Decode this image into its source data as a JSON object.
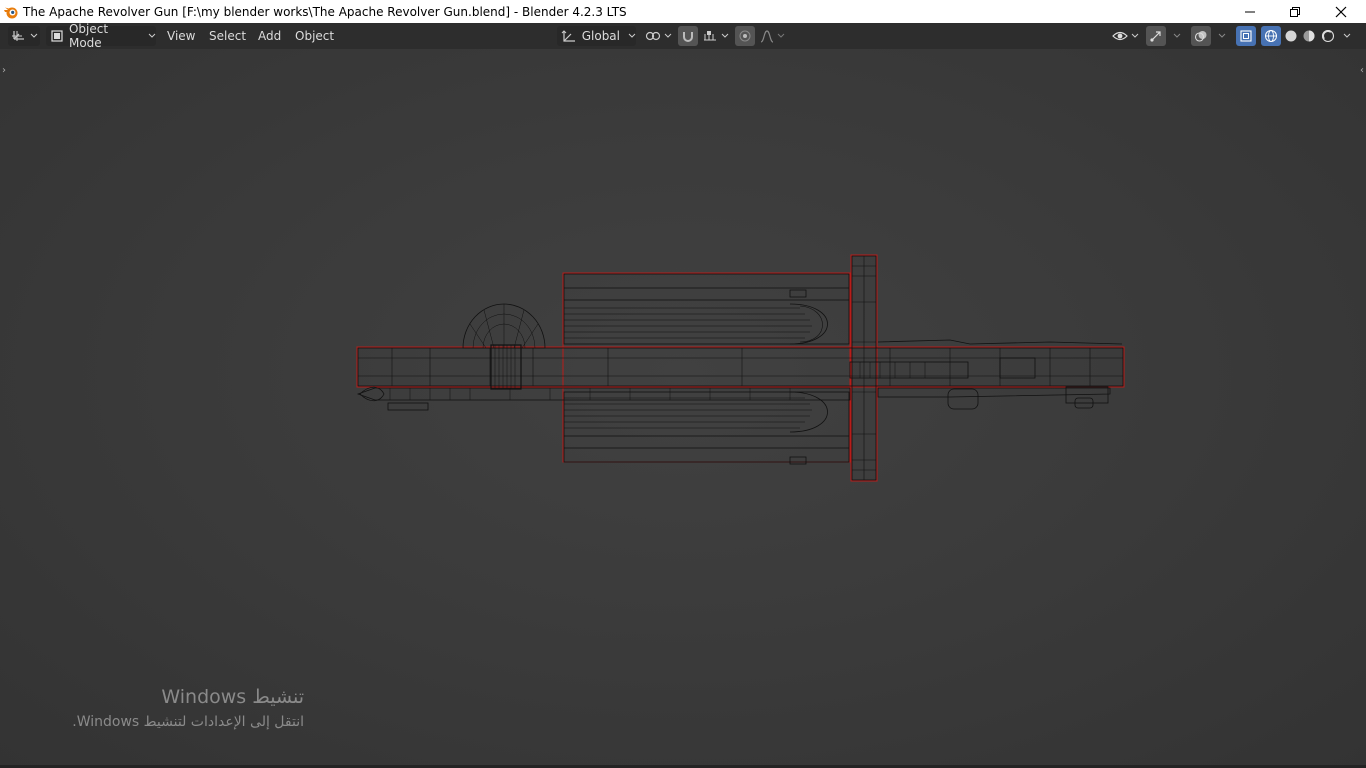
{
  "window": {
    "title": "The Apache Revolver Gun [F:\\my blender works\\The Apache Revolver Gun.blend] - Blender 4.2.3 LTS",
    "controls": [
      "minimize-icon",
      "restore-icon",
      "close-icon"
    ]
  },
  "header": {
    "editor_type_icon": "3d-viewport-icon",
    "mode": {
      "label": "Object Mode",
      "icon": "object-mode-icon"
    },
    "menus": [
      "View",
      "Select",
      "Add",
      "Object"
    ],
    "transform_orientation": {
      "label": "Global",
      "icon": "orientation-icon"
    },
    "pivot_icon": "pivot-point-icon",
    "snap_icon": "snap-magnet-icon",
    "snap_target_icon": "snap-increment-icon",
    "proportional_edit_icon": "proportional-edit-icon",
    "falloff_icon": "falloff-curve-icon",
    "visibility_icon": "eye-visibility-icon",
    "gizmo_icon": "gizmo-icon",
    "overlay_icon": "overlay-icon",
    "xray_icon": "xray-icon",
    "shading_modes": [
      "wireframe",
      "solid",
      "material-preview",
      "rendered"
    ],
    "active_shading": "wireframe",
    "colors": {
      "accent": "#4772b3",
      "header_bg": "#2d2d2d",
      "wire": "#0e0e0e",
      "selection_outline": "#c8201c"
    }
  },
  "viewport": {
    "watermark_line1": "تنشيط Windows",
    "watermark_line2": "انتقل إلى الإعدادات لتنشيط Windows."
  }
}
